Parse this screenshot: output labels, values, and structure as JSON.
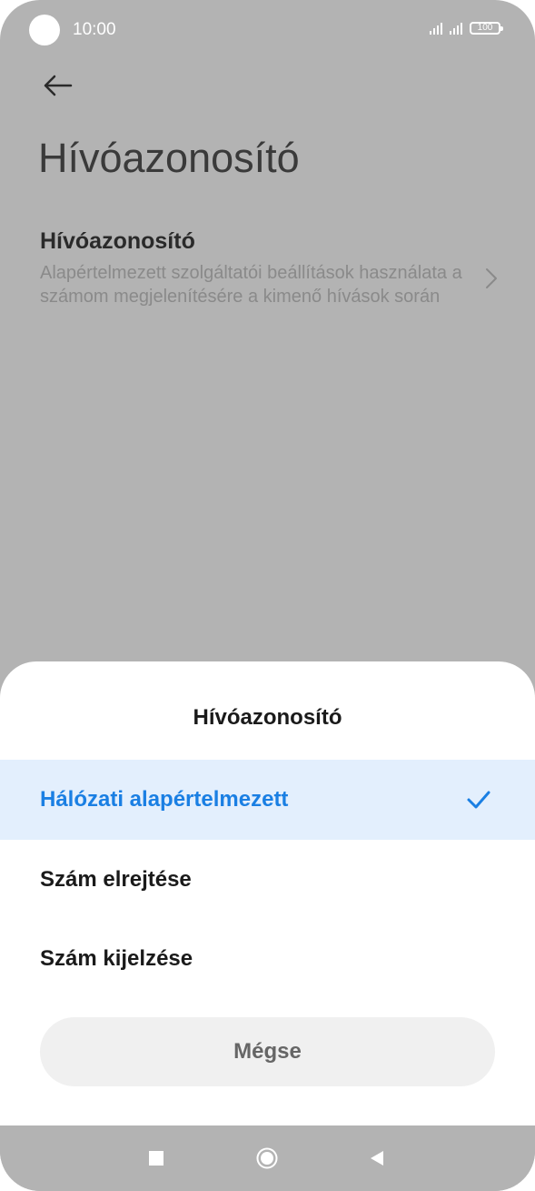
{
  "status_bar": {
    "time": "10:00",
    "battery_level": "100",
    "icons": [
      "signal-icon",
      "signal-icon",
      "battery-icon"
    ]
  },
  "header": {
    "back_icon": "arrow-left-icon",
    "title": "Hívóazonosító"
  },
  "setting": {
    "title": "Hívóazonosító",
    "description": "Alapértelmezett szolgáltatói beállítások használata a számom megjelenítésére a kimenő hívások során",
    "chevron_icon": "chevron-right-icon"
  },
  "dialog": {
    "title": "Hívóazonosító",
    "options": [
      {
        "label": "Hálózati alapértelmezett",
        "selected": true
      },
      {
        "label": "Szám elrejtése",
        "selected": false
      },
      {
        "label": "Szám kijelzése",
        "selected": false
      }
    ],
    "cancel_label": "Mégse",
    "accent_color": "#1a7fe3"
  },
  "nav_bar": {
    "icons": [
      "recents-square-icon",
      "home-circle-icon",
      "back-triangle-icon"
    ]
  }
}
